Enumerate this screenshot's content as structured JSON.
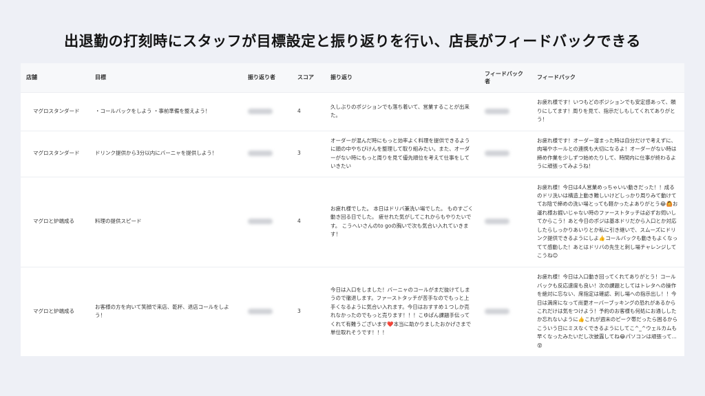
{
  "page": {
    "title": "出退勤の打刻時にスタッフが目標設定と振り返りを行い、店長がフィードバックできる"
  },
  "table": {
    "headers": {
      "store": "店舗",
      "goal": "目標",
      "reviewer": "振り返り者",
      "score": "スコア",
      "reflection": "振り返り",
      "feedback_by": "フィードバック者",
      "feedback": "フィードバック"
    },
    "rows": [
      {
        "store": "マグロスタンダード",
        "goal": "・コールバックをしよう ・事前準備を整えよう！",
        "score": "4",
        "reflection": "久しぶりのポジションでも落ち着いて、営業することが出来た。",
        "feedback": "お疲れ様です！いつもどのポジションでも安定感あって、頼りにしてます！周りを見て、指示だしもしてくれてありがとう！"
      },
      {
        "store": "マグロスタンダード",
        "goal": "ドリンク提供から3分以内にバーニャを提供しよう！",
        "score": "3",
        "reflection": "オーダーが混んだ時にもっと効率よく料理を提供できるように頭の中やちびけんを整理して取り組みたい。また、オーダーがない時にもっと周りを見て優先順位を考えて仕事をしていきたい",
        "feedback": "お疲れ様です！オーダー溜まった時は自分だけで考えずに、肉場やホールとの連携も大切になるよ！オーダーがない時は締め作業を少しずつ始めたりして、時間内に仕事が終わるように頑張ってみようね！"
      },
      {
        "store": "マグロと炉端成る",
        "goal": "料理の提供スピード",
        "score": "4",
        "reflection": "お疲れ様でした。 本日はドリバ兼洗い場でした。 ものすごく動き回る日でした。 疲せれた気がしてこれからもやりたいです。 こうへいさんのto goの胸いで次も気合い入れていきます！",
        "feedback": "お疲れ様！今日は4人営業めっちゃいい動きだった！！成るのドリ洗いは構造上動き難しいけどしっかり周りみて動けててお陰で締めの洗い場とっても軽かったよありがとう😂🙆お運れ様お掘いじゃない時のファーストタッチは必ずお伺いしてからこう！あと今日のポジは基本ドリだから入口とか対応したらしっかりあいりとか私に引き継いで、スムーズにドリンク提供できるようにしよ👍コールバックも動きもよくなってて感動した！あとはドリバの先生と刺し場チャレンジしてこうね😊"
      },
      {
        "store": "マグロと炉端成る",
        "goal": "お客様の方を向いて笑顔で来店、乾杯、退店コールをしよう！",
        "score": "3",
        "reflection": "今日は入口をしました！バーニャのコールがまだ抜けてしまうので徹退します。ファーストタッチが苦手なのでもっと上手くなるように気合い入れます。今日はおすすめ１つしか売れなかったのでもっと売ります！！！こゆぱん課題手伝ってくれて有難うございます❤️本当に助かりましたおかげさまで単位取れそうです！！！",
        "feedback": "お疲れ様！今日は入口動き回ってくれてありがとう！コールバックも反応速度も良い！次の課題としてはトレタへの操作を絶対に忘ない、席指定は確認、刺し場への指示出し！！今日は満席になって尚更オーバーブッキングの恐れがあるからこれだけは気をつけよう！予約のお客様も何処にお通ししたか忘れないように👍これが週末のピーク帯だったら困るからこういう日にミスなくできるようにしてこ^_^ウェルカムも早くなったみたいだし次披露してね😂パソコンは頑張って...😵"
      }
    ]
  }
}
